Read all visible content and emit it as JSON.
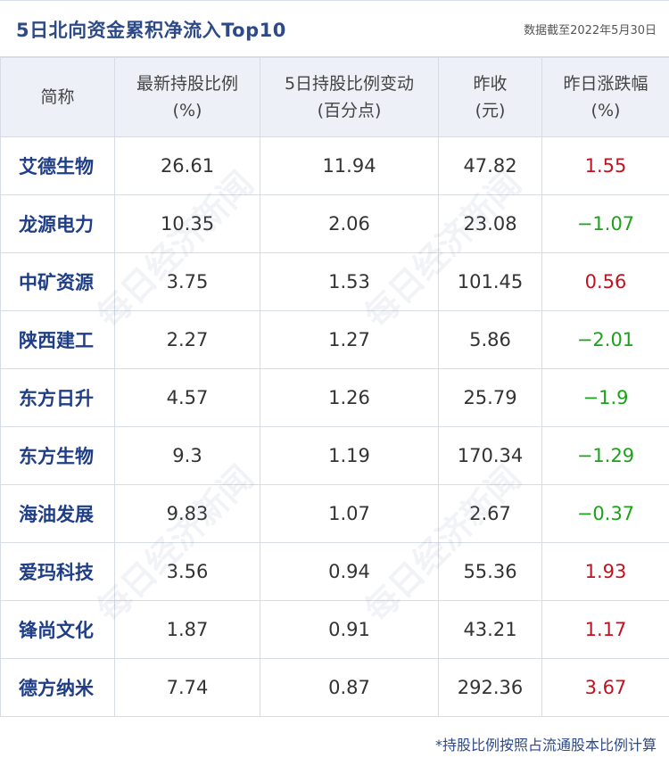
{
  "title": "5日北向资金累积净流入Top10",
  "date_note": "数据截至2022年5月30日",
  "footnote": "*持股比例按照占流通股本比例计算",
  "watermark": "每日经济新闻",
  "colors": {
    "up": "#c3121f",
    "down": "#1aa31a",
    "name": "#1f3e86",
    "header_bg": "#edf0f6"
  },
  "chart_data": {
    "type": "table",
    "columns": [
      {
        "line1": "简称",
        "line2": ""
      },
      {
        "line1": "最新持股比例",
        "line2": "(%)"
      },
      {
        "line1": "5日持股比例变动",
        "line2": "(百分点)"
      },
      {
        "line1": "昨收",
        "line2": "(元)"
      },
      {
        "line1": "昨日涨跌幅",
        "line2": "(%)"
      }
    ],
    "rows": [
      {
        "name": "艾德生物",
        "holding": "26.61",
        "change": "11.94",
        "close": "47.82",
        "pct": "1.55"
      },
      {
        "name": "龙源电力",
        "holding": "10.35",
        "change": "2.06",
        "close": "23.08",
        "pct": "−1.07"
      },
      {
        "name": "中矿资源",
        "holding": "3.75",
        "change": "1.53",
        "close": "101.45",
        "pct": "0.56"
      },
      {
        "name": "陕西建工",
        "holding": "2.27",
        "change": "1.27",
        "close": "5.86",
        "pct": "−2.01"
      },
      {
        "name": "东方日升",
        "holding": "4.57",
        "change": "1.26",
        "close": "25.79",
        "pct": "−1.9"
      },
      {
        "name": "东方生物",
        "holding": "9.3",
        "change": "1.19",
        "close": "170.34",
        "pct": "−1.29"
      },
      {
        "name": "海油发展",
        "holding": "9.83",
        "change": "1.07",
        "close": "2.67",
        "pct": "−0.37"
      },
      {
        "name": "爱玛科技",
        "holding": "3.56",
        "change": "0.94",
        "close": "55.36",
        "pct": "1.93"
      },
      {
        "name": "锋尚文化",
        "holding": "1.87",
        "change": "0.91",
        "close": "43.21",
        "pct": "1.17"
      },
      {
        "name": "德方纳米",
        "holding": "7.74",
        "change": "0.87",
        "close": "292.36",
        "pct": "3.67"
      }
    ]
  }
}
